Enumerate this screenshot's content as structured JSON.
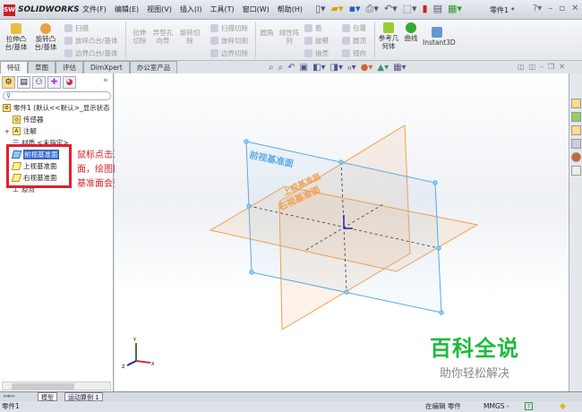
{
  "app": {
    "logo": "SOLIDWORKS",
    "logo_mark": "SW",
    "document": "零件1 *"
  },
  "menu": [
    "文件(F)",
    "编辑(E)",
    "视图(V)",
    "插入(I)",
    "工具(T)",
    "窗口(W)",
    "帮助(H)"
  ],
  "ribbon": {
    "extrude_boss": "拉伸凸台/基体",
    "revolve_boss": "旋转凸台/基体",
    "sweep": "扫描",
    "loft_boss": "放样凸台/基体",
    "boundary_boss": "边界凸台/基体",
    "extrude_cut": "拉伸切除",
    "hole_wizard": "异型孔向导",
    "revolve_cut": "旋转切除",
    "sweep_cut": "扫描切除",
    "loft_cut": "放样切割",
    "boundary_cut": "边界切除",
    "fillet": "圆角",
    "linear_pattern": "线性阵列",
    "rib": "筋",
    "draft": "拔模",
    "shell": "抽壳",
    "wrap": "包覆",
    "dome": "圆顶",
    "mirror": "镜向",
    "ref_geometry": "参考几何体",
    "curves": "曲线",
    "instant3d": "Instant3D"
  },
  "tabs": [
    "特征",
    "草图",
    "评估",
    "DimXpert",
    "办公室产品"
  ],
  "active_tab": "特征",
  "tree": {
    "root": "零件1 (默认<<默认>_显示状态",
    "items": [
      "传感器",
      "注解",
      "材质 <未指定>",
      "前视基准面",
      "上视基准面",
      "右视基准面",
      "原点"
    ],
    "selected": "前视基准面"
  },
  "annotation": [
    "鼠标点击三个基准",
    "面，绘图区域的对应",
    "基准面会变成蓝色"
  ],
  "viewport": {
    "front_plane_label": "前视基准面",
    "top_plane_label": "上视基准面",
    "right_plane_label": "右视基准面",
    "front_color": "#5aa9e6",
    "other_color": "#f0a050",
    "triad": {
      "x": "X",
      "y": "Y",
      "z": "Z"
    }
  },
  "watermark": {
    "title": "百科全说",
    "subtitle": "助你轻松解决"
  },
  "bottom_tabs": [
    "模型",
    "运动算例 1"
  ],
  "status": {
    "left": "零件1",
    "mode": "在编辑 零件",
    "units": "MMGS -",
    "help": "?"
  }
}
